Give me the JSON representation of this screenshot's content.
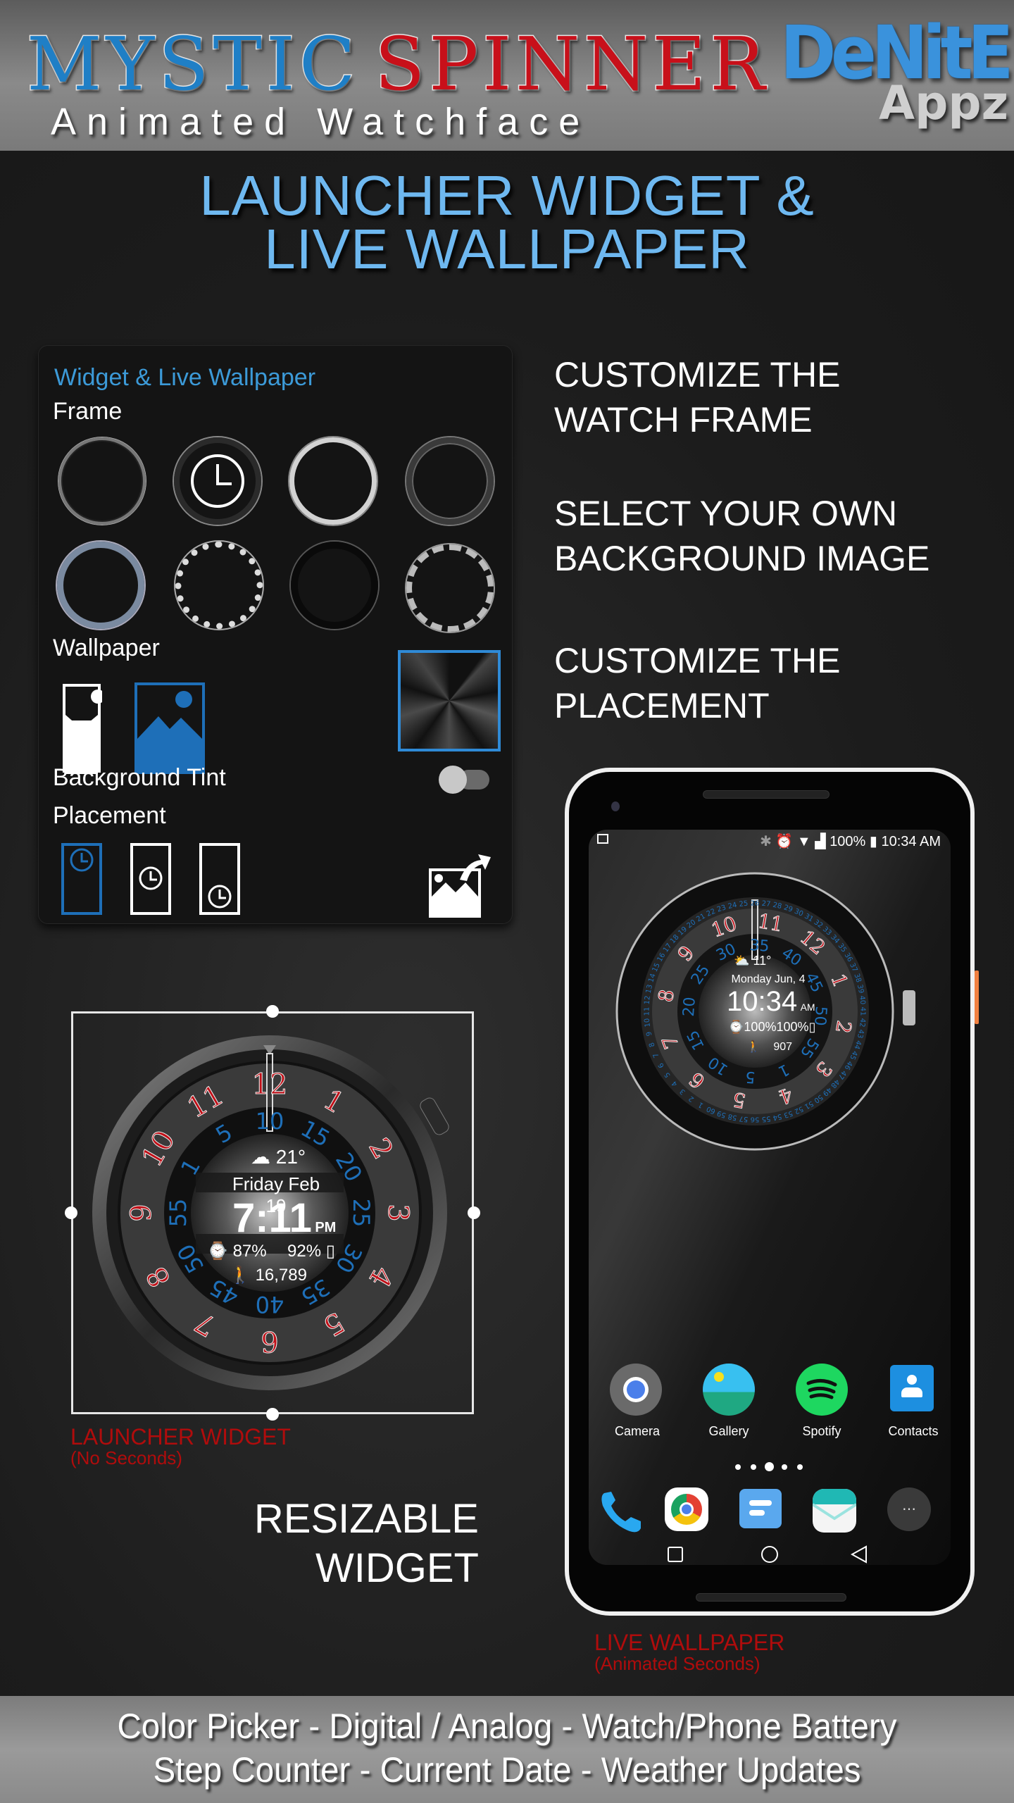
{
  "header": {
    "title_word_1": "MYSTIC",
    "title_word_2": "SPINNER",
    "subtitle": "Animated Watchface",
    "logo_main": "DeNitE!",
    "logo_sub": "Appz",
    "colors": {
      "blue": "#1f7fc6",
      "red": "#c8101a"
    }
  },
  "heading": {
    "line1": "LAUNCHER WIDGET &",
    "line2": "LIVE WALLPAPER",
    "color": "#6eb8f0"
  },
  "settings_panel": {
    "title": "Widget & Live Wallpaper",
    "frame_label": "Frame",
    "frames": [
      {
        "name": "frame-thin-black"
      },
      {
        "name": "frame-default-selected"
      },
      {
        "name": "frame-silver"
      },
      {
        "name": "frame-dark-steel"
      },
      {
        "name": "frame-blue-steel"
      },
      {
        "name": "frame-diamond"
      },
      {
        "name": "frame-black-matte"
      },
      {
        "name": "frame-knurled-silver"
      }
    ],
    "wallpaper_label": "Wallpaper",
    "background_tint_label": "Background Tint",
    "background_tint_on": false,
    "placement_label": "Placement",
    "placement_options": [
      "top",
      "center",
      "bottom"
    ],
    "placement_selected": "top",
    "accent_color": "#2f8ad6"
  },
  "features": [
    {
      "line1": "CUSTOMIZE THE",
      "line2": "WATCH FRAME"
    },
    {
      "line1": "SELECT YOUR OWN",
      "line2": "BACKGROUND IMAGE"
    },
    {
      "line1": "CUSTOMIZE THE",
      "line2": "PLACEMENT"
    }
  ],
  "widget": {
    "weather_temp": "21°",
    "date": "Friday Feb 19",
    "time": "7:11",
    "ampm": "PM",
    "watch_battery": "87%",
    "phone_battery": "92%",
    "steps": "16,789",
    "hour_numbers": [
      "12",
      "1",
      "2",
      "3",
      "4",
      "5",
      "6",
      "7",
      "8",
      "9",
      "10",
      "11"
    ],
    "minute_numbers": [
      "10",
      "15",
      "20",
      "25",
      "30",
      "35",
      "40",
      "45",
      "50",
      "55",
      "1",
      "5"
    ],
    "caption": "LAUNCHER WIDGET",
    "caption_sub": "(No Seconds)"
  },
  "resizable": {
    "line1": "RESIZABLE",
    "line2": "WIDGET"
  },
  "phone": {
    "status": {
      "battery": "100%",
      "time": "10:34 AM"
    },
    "watch": {
      "weather_temp": "11°",
      "date": "Monday Jun, 4",
      "time": "10:34",
      "ampm": "AM",
      "battery": "100%100%",
      "steps": "907"
    },
    "apps": [
      {
        "label": "Camera"
      },
      {
        "label": "Gallery"
      },
      {
        "label": "Spotify"
      },
      {
        "label": "Contacts"
      }
    ],
    "page_indicator": {
      "pages": 5,
      "current": 3
    },
    "caption": "LIVE WALLPAPER",
    "caption_sub": "(Animated Seconds)"
  },
  "footer": {
    "line1": "Color Picker - Digital / Analog - Watch/Phone Battery",
    "line2": "Step Counter - Current Date - Weather Updates"
  }
}
